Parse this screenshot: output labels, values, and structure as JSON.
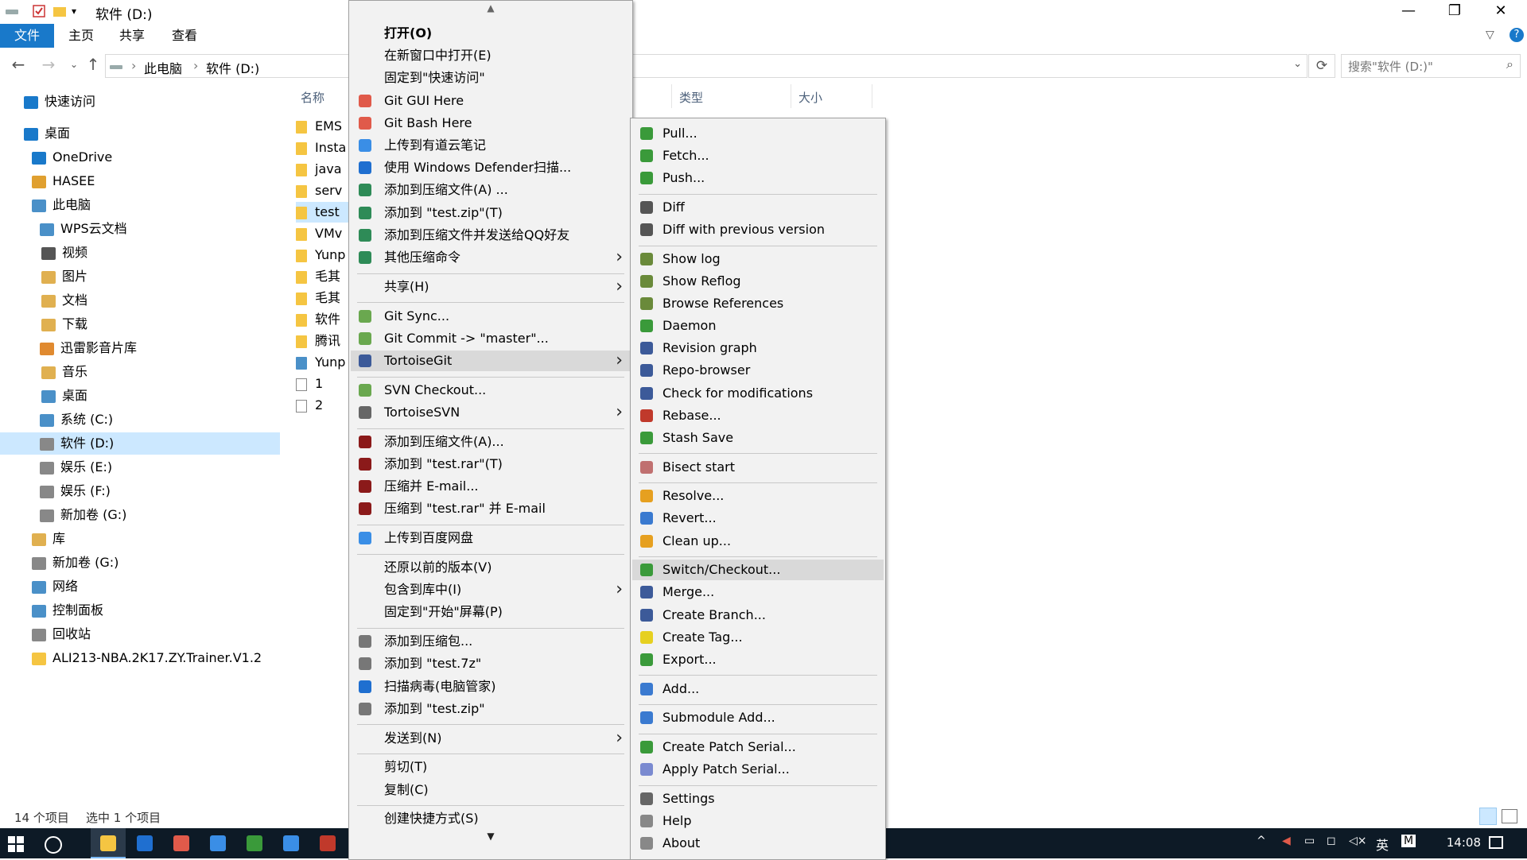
{
  "window": {
    "title": "软件 (D:)",
    "controls": {
      "minimize": "—",
      "restore": "❐",
      "close": "✕"
    }
  },
  "ribbon": {
    "tabs": [
      "文件",
      "主页",
      "共享",
      "查看"
    ],
    "help": "?"
  },
  "address": {
    "crumbs": [
      "此电脑",
      "软件 (D:)"
    ],
    "search_placeholder": "搜索\"软件 (D:)\""
  },
  "nav": {
    "items": [
      {
        "label": "快速访问",
        "icon": "star-icon",
        "color": "#1979ca"
      },
      {
        "label": "桌面",
        "icon": "desktop-icon",
        "color": "#1979ca"
      },
      {
        "label": "OneDrive",
        "icon": "cloud-icon",
        "color": "#1979ca"
      },
      {
        "label": "HASEE",
        "icon": "user-icon",
        "color": "#e0a030"
      },
      {
        "label": "此电脑",
        "icon": "pc-icon",
        "color": "#4a90c8"
      },
      {
        "label": "WPS云文档",
        "icon": "cloud-icon",
        "color": "#4a90c8"
      },
      {
        "label": "视频",
        "icon": "video-icon",
        "color": "#555"
      },
      {
        "label": "图片",
        "icon": "picture-icon",
        "color": "#e0b050"
      },
      {
        "label": "文档",
        "icon": "document-icon",
        "color": "#e0b050"
      },
      {
        "label": "下载",
        "icon": "download-icon",
        "color": "#e0b050"
      },
      {
        "label": "迅雷影音片库",
        "icon": "folder-icon",
        "color": "#e08a30"
      },
      {
        "label": "音乐",
        "icon": "music-icon",
        "color": "#e0b050"
      },
      {
        "label": "桌面",
        "icon": "desktop-icon",
        "color": "#4a90c8"
      },
      {
        "label": "系统 (C:)",
        "icon": "drive-icon",
        "color": "#4a90c8"
      },
      {
        "label": "软件 (D:)",
        "icon": "drive-icon",
        "color": "#888"
      },
      {
        "label": "娱乐 (E:)",
        "icon": "drive-icon",
        "color": "#888"
      },
      {
        "label": "娱乐 (F:)",
        "icon": "drive-icon",
        "color": "#888"
      },
      {
        "label": "新加卷 (G:)",
        "icon": "drive-icon",
        "color": "#888"
      },
      {
        "label": "库",
        "icon": "library-icon",
        "color": "#e0b050"
      },
      {
        "label": "新加卷 (G:)",
        "icon": "drive-icon",
        "color": "#888"
      },
      {
        "label": "网络",
        "icon": "network-icon",
        "color": "#4a90c8"
      },
      {
        "label": "控制面板",
        "icon": "control-panel-icon",
        "color": "#4a90c8"
      },
      {
        "label": "回收站",
        "icon": "recycle-bin-icon",
        "color": "#888"
      },
      {
        "label": "ALI213-NBA.2K17.ZY.Trainer.V1.2",
        "icon": "folder-icon",
        "color": "#f5c542"
      }
    ]
  },
  "filelist": {
    "columns": {
      "name": "名称",
      "type": "类型",
      "size": "大小"
    },
    "rows": [
      {
        "name": "EMS",
        "kind": "folder"
      },
      {
        "name": "Insta",
        "kind": "folder"
      },
      {
        "name": "java",
        "kind": "folder"
      },
      {
        "name": "serv",
        "kind": "folder"
      },
      {
        "name": "test",
        "kind": "folder",
        "selected": true
      },
      {
        "name": "VMv",
        "kind": "folder"
      },
      {
        "name": "Yunp",
        "kind": "folder"
      },
      {
        "name": "毛其",
        "kind": "folder"
      },
      {
        "name": "毛其",
        "kind": "folder"
      },
      {
        "name": "软件",
        "kind": "folder"
      },
      {
        "name": "腾讯",
        "kind": "folder"
      },
      {
        "name": "Yunp",
        "kind": "app"
      },
      {
        "name": "1",
        "kind": "doc"
      },
      {
        "name": "2",
        "kind": "doc"
      }
    ]
  },
  "status": {
    "count": "14 个项目",
    "selection": "选中 1 个项目"
  },
  "context_menu": {
    "scroll_up": "▲",
    "scroll_down": "▼",
    "items": [
      {
        "label": "打开(O)",
        "bold": true
      },
      {
        "label": "在新窗口中打开(E)"
      },
      {
        "label": "固定到\"快速访问\""
      },
      {
        "label": "Git GUI Here",
        "icon": "git-icon",
        "color": "#e05a4a"
      },
      {
        "label": "Git Bash Here",
        "icon": "git-icon",
        "color": "#e05a4a"
      },
      {
        "label": "上传到有道云笔记",
        "icon": "youdao-icon",
        "color": "#3a8ee6"
      },
      {
        "label": "使用 Windows Defender扫描...",
        "icon": "defender-icon",
        "color": "#1f6fd0"
      },
      {
        "label": "添加到压缩文件(A) ...",
        "icon": "archive-icon",
        "color": "#2e8b57"
      },
      {
        "label": "添加到 \"test.zip\"(T)",
        "icon": "archive-icon",
        "color": "#2e8b57"
      },
      {
        "label": "添加到压缩文件并发送给QQ好友",
        "icon": "archive-icon",
        "color": "#2e8b57"
      },
      {
        "label": "其他压缩命令",
        "icon": "archive-icon",
        "color": "#2e8b57",
        "submenu": true
      },
      {
        "sep": true
      },
      {
        "label": "共享(H)",
        "submenu": true
      },
      {
        "sep": true
      },
      {
        "label": "Git Sync...",
        "icon": "git-sync-icon",
        "color": "#6aa84f"
      },
      {
        "label": "Git Commit -> \"master\"...",
        "icon": "git-commit-icon",
        "color": "#6aa84f"
      },
      {
        "label": "TortoiseGit",
        "icon": "tortoisegit-icon",
        "color": "#3c5a99",
        "submenu": true,
        "highlighted": true
      },
      {
        "sep": true
      },
      {
        "label": "SVN Checkout...",
        "icon": "svn-checkout-icon",
        "color": "#6aa84f"
      },
      {
        "label": "TortoiseSVN",
        "icon": "tortoisesvn-icon",
        "color": "#666",
        "submenu": true
      },
      {
        "sep": true
      },
      {
        "label": "添加到压缩文件(A)...",
        "icon": "winrar-icon",
        "color": "#8b1a1a"
      },
      {
        "label": "添加到 \"test.rar\"(T)",
        "icon": "winrar-icon",
        "color": "#8b1a1a"
      },
      {
        "label": "压缩并 E-mail...",
        "icon": "winrar-icon",
        "color": "#8b1a1a"
      },
      {
        "label": "压缩到 \"test.rar\" 并 E-mail",
        "icon": "winrar-icon",
        "color": "#8b1a1a"
      },
      {
        "sep": true
      },
      {
        "label": "上传到百度网盘",
        "icon": "baidu-icon",
        "color": "#3a8ee6"
      },
      {
        "sep": true
      },
      {
        "label": "还原以前的版本(V)"
      },
      {
        "label": "包含到库中(I)",
        "submenu": true
      },
      {
        "label": "固定到\"开始\"屏幕(P)"
      },
      {
        "sep": true
      },
      {
        "label": "添加到压缩包...",
        "icon": "7zip-icon",
        "color": "#777"
      },
      {
        "label": "添加到 \"test.7z\"",
        "icon": "7zip-icon",
        "color": "#777"
      },
      {
        "label": "扫描病毒(电脑管家)",
        "icon": "shield-icon",
        "color": "#1f6fd0"
      },
      {
        "label": "添加到 \"test.zip\"",
        "icon": "7zip-icon",
        "color": "#777"
      },
      {
        "sep": true
      },
      {
        "label": "发送到(N)",
        "submenu": true
      },
      {
        "sep": true
      },
      {
        "label": "剪切(T)"
      },
      {
        "label": "复制(C)"
      },
      {
        "sep": true
      },
      {
        "label": "创建快捷方式(S)"
      }
    ]
  },
  "submenu": {
    "items": [
      {
        "label": "Pull...",
        "icon": "pull-icon",
        "color": "#3a9a3a"
      },
      {
        "label": "Fetch...",
        "icon": "fetch-icon",
        "color": "#3a9a3a"
      },
      {
        "label": "Push...",
        "icon": "push-icon",
        "color": "#3a9a3a"
      },
      {
        "sep": true
      },
      {
        "label": "Diff",
        "icon": "diff-icon",
        "color": "#555"
      },
      {
        "label": "Diff with previous version",
        "icon": "diff-icon",
        "color": "#555"
      },
      {
        "sep": true
      },
      {
        "label": "Show log",
        "icon": "log-icon",
        "color": "#6a8a3a"
      },
      {
        "label": "Show Reflog",
        "icon": "reflog-icon",
        "color": "#6a8a3a"
      },
      {
        "label": "Browse References",
        "icon": "references-icon",
        "color": "#6a8a3a"
      },
      {
        "label": "Daemon",
        "icon": "daemon-icon",
        "color": "#3a9a3a"
      },
      {
        "label": "Revision graph",
        "icon": "revision-graph-icon",
        "color": "#3c5a99"
      },
      {
        "label": "Repo-browser",
        "icon": "repo-browser-icon",
        "color": "#3c5a99"
      },
      {
        "label": "Check for modifications",
        "icon": "modifications-icon",
        "color": "#3c5a99"
      },
      {
        "label": "Rebase...",
        "icon": "rebase-icon",
        "color": "#c0392b"
      },
      {
        "label": "Stash Save",
        "icon": "stash-icon",
        "color": "#3a9a3a"
      },
      {
        "sep": true
      },
      {
        "label": "Bisect start",
        "icon": "bisect-icon",
        "color": "#c07070"
      },
      {
        "sep": true
      },
      {
        "label": "Resolve...",
        "icon": "resolve-icon",
        "color": "#e6a020"
      },
      {
        "label": "Revert...",
        "icon": "revert-icon",
        "color": "#3a7ad0"
      },
      {
        "label": "Clean up...",
        "icon": "cleanup-icon",
        "color": "#e6a020"
      },
      {
        "sep": true
      },
      {
        "label": "Switch/Checkout...",
        "icon": "switch-icon",
        "color": "#3a9a3a",
        "highlighted": true
      },
      {
        "label": "Merge...",
        "icon": "merge-icon",
        "color": "#3c5a99"
      },
      {
        "label": "Create Branch...",
        "icon": "branch-icon",
        "color": "#3c5a99"
      },
      {
        "label": "Create Tag...",
        "icon": "tag-icon",
        "color": "#e6d020"
      },
      {
        "label": "Export...",
        "icon": "export-icon",
        "color": "#3a9a3a"
      },
      {
        "sep": true
      },
      {
        "label": "Add...",
        "icon": "add-icon",
        "color": "#3a7ad0"
      },
      {
        "sep": true
      },
      {
        "label": "Submodule Add...",
        "icon": "submodule-icon",
        "color": "#3a7ad0"
      },
      {
        "sep": true
      },
      {
        "label": "Create Patch Serial...",
        "icon": "patch-icon",
        "color": "#3a9a3a"
      },
      {
        "label": "Apply Patch Serial...",
        "icon": "apply-patch-icon",
        "color": "#7a8ad0"
      },
      {
        "sep": true
      },
      {
        "label": "Settings",
        "icon": "settings-icon",
        "color": "#666"
      },
      {
        "label": "Help",
        "icon": "help-icon",
        "color": "#888"
      },
      {
        "label": "About",
        "icon": "about-icon",
        "color": "#888"
      }
    ]
  },
  "taskbar": {
    "clock": "14:08",
    "tray_text": "英",
    "tray_letter": "M",
    "apps": [
      {
        "icon": "file-explorer-icon",
        "color": "#f5c542"
      },
      {
        "icon": "store-icon",
        "color": "#1f6fd0"
      },
      {
        "icon": "chrome-icon",
        "color": "#e05a4a"
      },
      {
        "icon": "app-icon",
        "color": "#3a8ee6"
      },
      {
        "icon": "wechat-icon",
        "color": "#3a9a3a"
      },
      {
        "icon": "browser-icon",
        "color": "#3a8ee6"
      },
      {
        "icon": "app-icon",
        "color": "#c0392b"
      }
    ]
  }
}
